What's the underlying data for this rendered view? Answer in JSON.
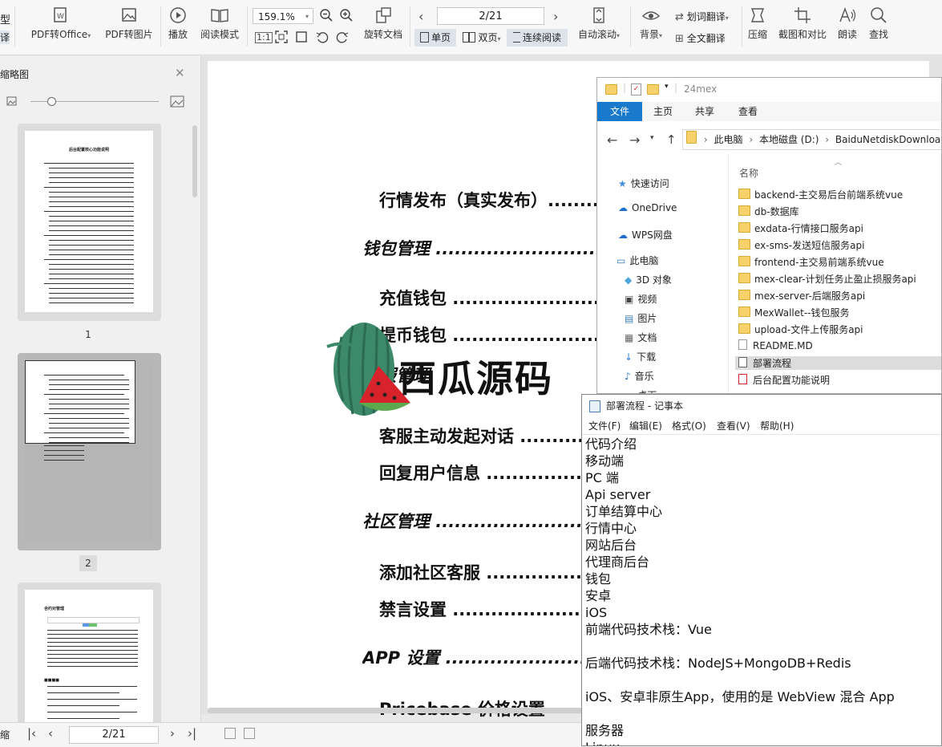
{
  "toolbar": {
    "edge_top": "型",
    "edge_bottom": "译",
    "pdf_to_office": "PDF转Office",
    "pdf_to_image": "PDF转图片",
    "play": "播放",
    "read_mode": "阅读模式",
    "zoom": "159.1%",
    "rotate_doc": "旋转文档",
    "page_display": "2/21",
    "single_page": "单页",
    "double_page": "双页",
    "continuous": "连续阅读",
    "auto_scroll": "自动滚动",
    "background": "背景",
    "word_translate": "划词翻译",
    "full_translate": "全文翻译",
    "compress": "压缩",
    "screenshot_compare": "截图和对比",
    "read_aloud": "朗读",
    "find": "查找"
  },
  "sidebar": {
    "title": "缩略图",
    "thumbnails": [
      {
        "label": "1",
        "title": "后台配置核心功能说明"
      },
      {
        "label": "2"
      },
      {
        "label": "3",
        "title": "合约对管理"
      }
    ]
  },
  "document": {
    "toc": [
      {
        "text": "行情发布（真实发布）..........",
        "level": 3
      },
      {
        "text": "钱包管理 ........................................................",
        "level": 2
      },
      {
        "text": "充值钱包 ..................................................",
        "level": 3
      },
      {
        "text": "提币钱包 ..................................................",
        "level": 3
      },
      {
        "text": "客服管理",
        "level": 2
      },
      {
        "text": "客服主动发起对话 ...................................",
        "level": 3
      },
      {
        "text": "回复用户信息 ...........................................",
        "level": 3
      },
      {
        "text": "社区管理 ........................................................",
        "level": 2
      },
      {
        "text": "添加社区客服 ...........................................",
        "level": 3
      },
      {
        "text": "禁言设置 ..................................................",
        "level": 3
      },
      {
        "text": "APP 设置 ........................................................",
        "level": 2
      },
      {
        "text": "Pricebase 价格设置",
        "level": 3
      }
    ]
  },
  "watermark": {
    "text": "西瓜源码"
  },
  "statusbar": {
    "page": "2/21",
    "left_edge": "缩"
  },
  "explorer": {
    "title": "24mex",
    "tabs": [
      "文件",
      "主页",
      "共享",
      "查看"
    ],
    "breadcrumb": [
      "此电脑",
      "本地磁盘 (D:)",
      "BaiduNetdiskDownload"
    ],
    "column_name": "名称",
    "nav": [
      "快速访问",
      "OneDrive",
      "WPS网盘",
      "此电脑",
      "3D 对象",
      "视频",
      "图片",
      "文档",
      "下载",
      "音乐",
      "桌面"
    ],
    "files": [
      {
        "name": "backend-主交易后台前端系统vue",
        "type": "folder"
      },
      {
        "name": "db-数据库",
        "type": "folder"
      },
      {
        "name": "exdata-行情接口服务api",
        "type": "folder"
      },
      {
        "name": "ex-sms-发送短信服务api",
        "type": "folder"
      },
      {
        "name": "frontend-主交易前端系统vue",
        "type": "folder"
      },
      {
        "name": "mex-clear-计划任务止盈止损服务api",
        "type": "folder"
      },
      {
        "name": "mex-server-后端服务api",
        "type": "folder"
      },
      {
        "name": "MexWallet--钱包服务",
        "type": "folder"
      },
      {
        "name": "upload-文件上传服务api",
        "type": "folder"
      },
      {
        "name": "README.MD",
        "type": "file"
      },
      {
        "name": "部署流程",
        "type": "text",
        "selected": true
      },
      {
        "name": "后台配置功能说明",
        "type": "pdf"
      }
    ]
  },
  "notepad": {
    "title": "部署流程 - 记事本",
    "menu": [
      "文件(F)",
      "编辑(E)",
      "格式(O)",
      "查看(V)",
      "帮助(H)"
    ],
    "lines": [
      "代码介绍",
      "移动端",
      "PC 端",
      "Api server",
      "订单结算中心",
      "行情中心",
      "网站后台",
      "代理商后台",
      "钱包",
      "安卓",
      "iOS",
      "前端代码技术栈：Vue",
      "",
      "后端代码技术栈：NodeJS+MongoDB+Redis",
      "",
      "iOS、安卓非原生App，使用的是 WebView 混合 App",
      "",
      "服务器",
      "Linux"
    ]
  }
}
